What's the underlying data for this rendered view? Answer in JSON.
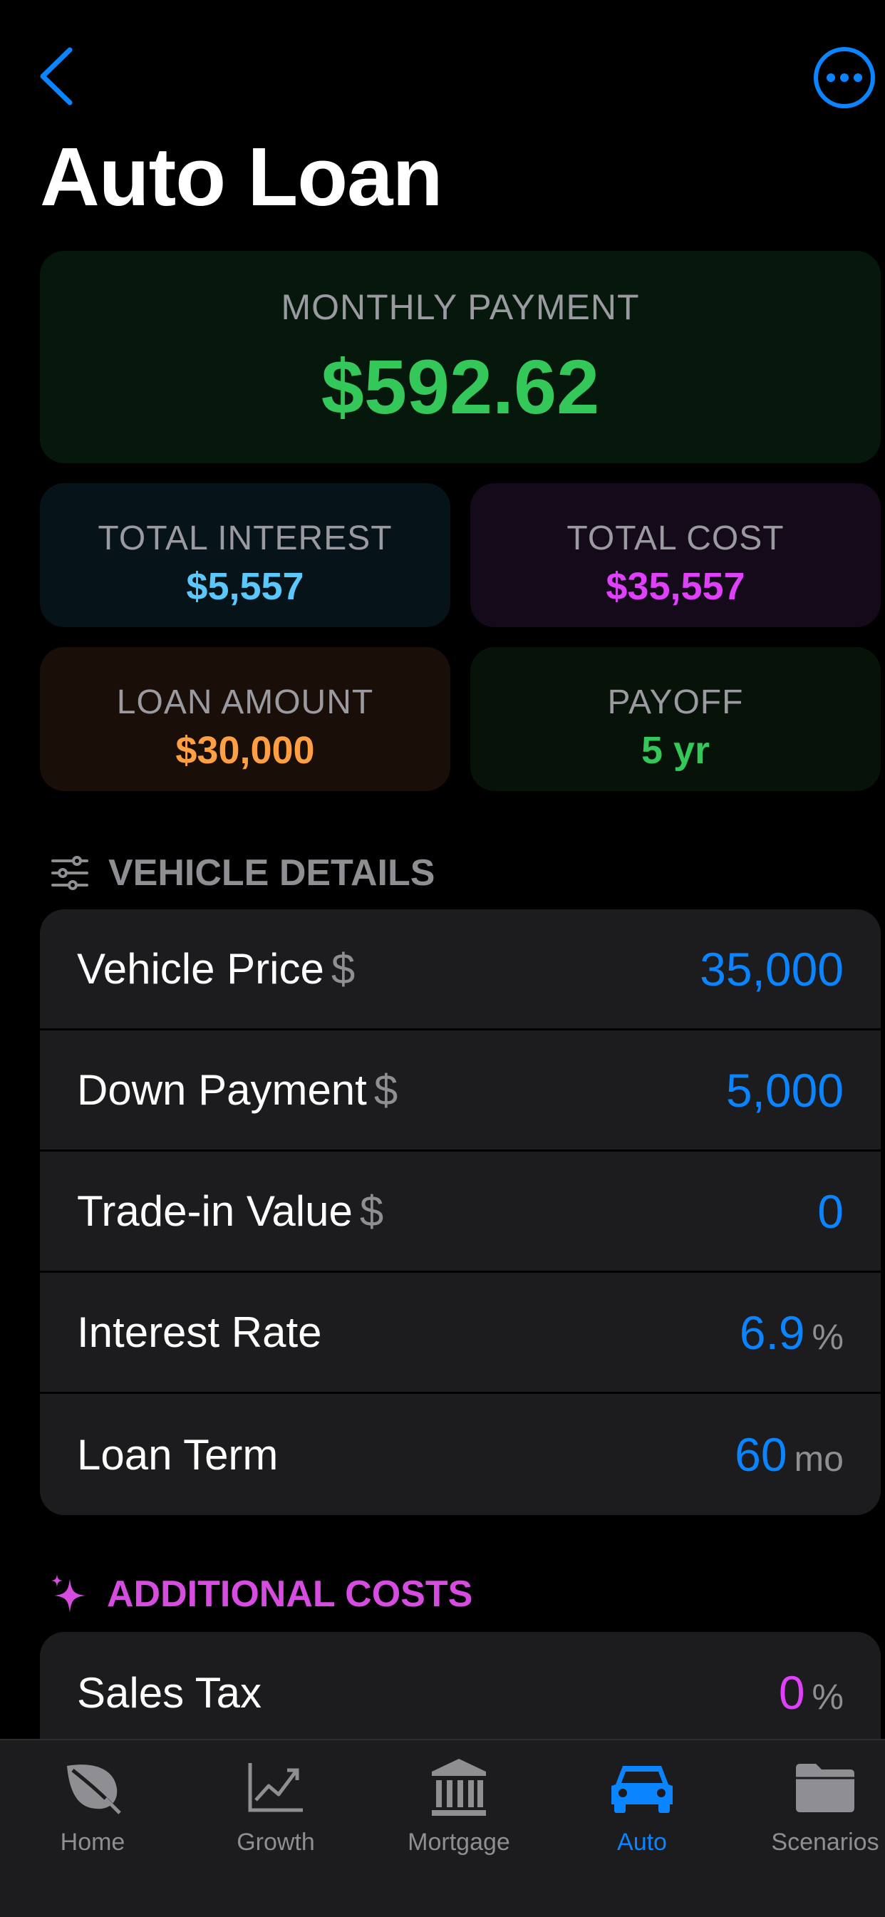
{
  "header": {
    "title": "Auto Loan",
    "back_icon": "chevron-left-icon",
    "more_icon": "ellipsis-circle-icon"
  },
  "summary": {
    "monthly_payment": {
      "label": "MONTHLY PAYMENT",
      "value": "$592.62"
    },
    "total_interest": {
      "label": "TOTAL INTEREST",
      "value": "$5,557"
    },
    "total_cost": {
      "label": "TOTAL COST",
      "value": "$35,557"
    },
    "loan_amount": {
      "label": "LOAN AMOUNT",
      "value": "$30,000"
    },
    "payoff": {
      "label": "PAYOFF",
      "value": "5 yr"
    }
  },
  "vehicle_details": {
    "title": "VEHICLE DETAILS",
    "rows": [
      {
        "label": "Vehicle Price",
        "prefix": "$",
        "value": "35,000",
        "suffix": ""
      },
      {
        "label": "Down Payment",
        "prefix": "$",
        "value": "5,000",
        "suffix": ""
      },
      {
        "label": "Trade-in Value",
        "prefix": "$",
        "value": "0",
        "suffix": ""
      },
      {
        "label": "Interest Rate",
        "prefix": "",
        "value": "6.9",
        "suffix": "%"
      },
      {
        "label": "Loan Term",
        "prefix": "",
        "value": "60",
        "suffix": "mo"
      }
    ]
  },
  "additional_costs": {
    "title": "ADDITIONAL COSTS",
    "rows": [
      {
        "label": "Sales Tax",
        "value": "0",
        "suffix": "%"
      }
    ]
  },
  "tabbar": {
    "tabs": [
      {
        "label": "Home",
        "icon": "leaf-icon"
      },
      {
        "label": "Growth",
        "icon": "chart-line-icon"
      },
      {
        "label": "Mortgage",
        "icon": "bank-icon"
      },
      {
        "label": "Auto",
        "icon": "car-icon"
      },
      {
        "label": "Scenarios",
        "icon": "folder-icon"
      }
    ],
    "active": "Auto"
  },
  "colors": {
    "accent": "#0a84ff",
    "green": "#34c759",
    "cyan": "#5ac8fa",
    "magenta": "#e040fb",
    "orange": "#ff9f43"
  }
}
